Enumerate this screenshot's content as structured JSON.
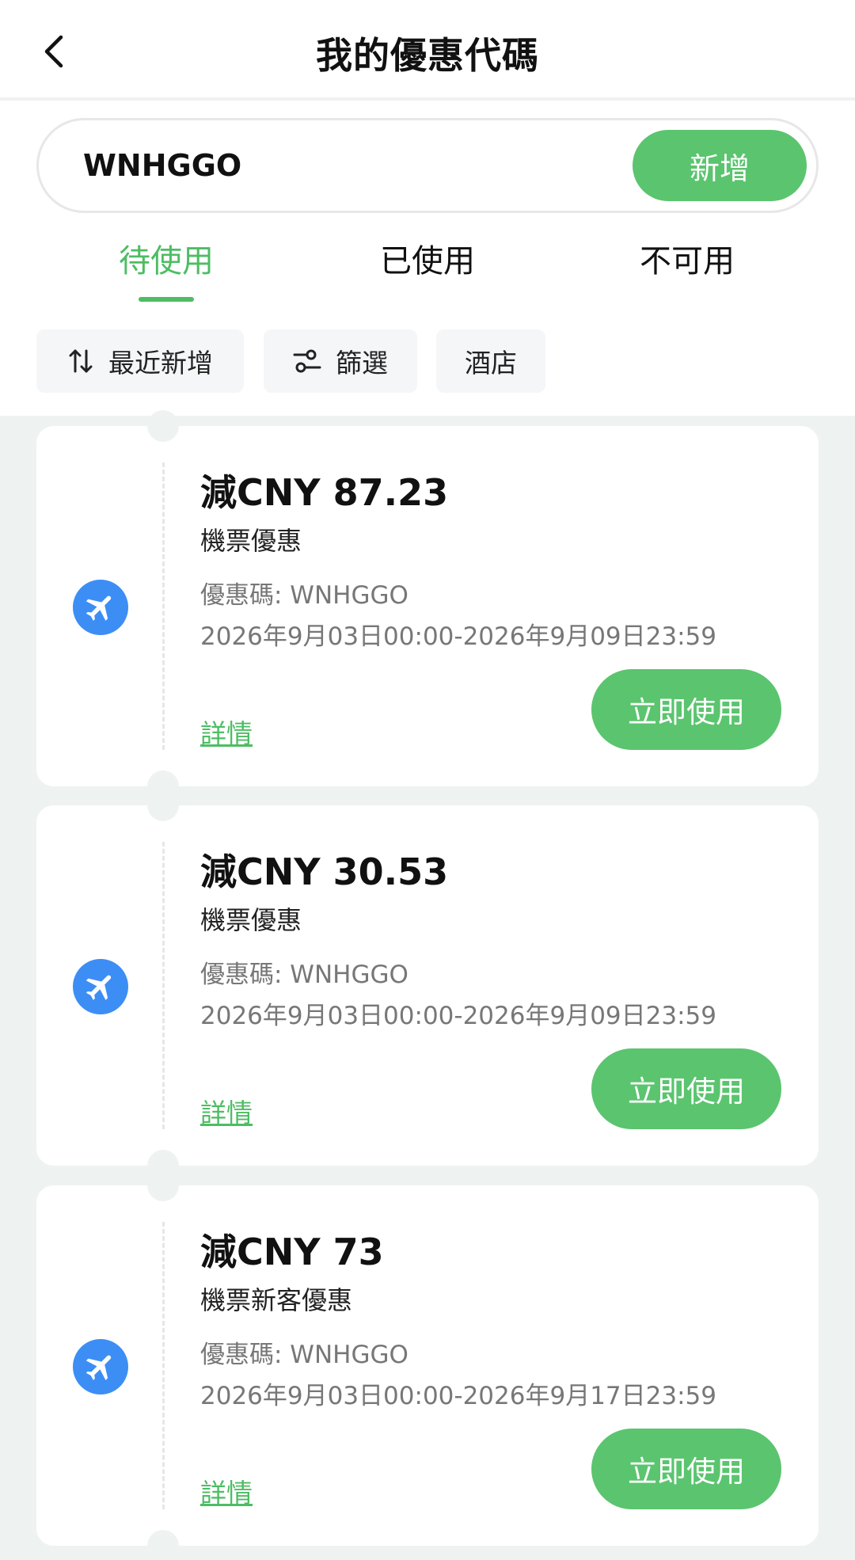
{
  "header": {
    "title": "我的優惠代碼"
  },
  "search": {
    "value": "WNHGGO",
    "add_label": "新增"
  },
  "tabs": [
    {
      "label": "待使用",
      "active": true
    },
    {
      "label": "已使用",
      "active": false
    },
    {
      "label": "不可用",
      "active": false
    }
  ],
  "filters": {
    "sort_label": "最近新增",
    "filter_label": "篩選",
    "category_label": "酒店"
  },
  "coupons": [
    {
      "amount": "減CNY 87.23",
      "type": "機票優惠",
      "code": "優惠碼: WNHGGO",
      "validity": "2026年9月03日00:00-2026年9月09日23:59",
      "details_label": "詳情",
      "use_label": "立即使用"
    },
    {
      "amount": "減CNY 30.53",
      "type": "機票優惠",
      "code": "優惠碼: WNHGGO",
      "validity": "2026年9月03日00:00-2026年9月09日23:59",
      "details_label": "詳情",
      "use_label": "立即使用"
    },
    {
      "amount": "減CNY 73",
      "type": "機票新客優惠",
      "code": "優惠碼: WNHGGO",
      "validity": "2026年9月03日00:00-2026年9月17日23:59",
      "details_label": "詳情",
      "use_label": "立即使用"
    }
  ],
  "colors": {
    "accent": "#5bc46f",
    "icon_blue": "#3c8ef5",
    "background": "#eef3f2"
  }
}
